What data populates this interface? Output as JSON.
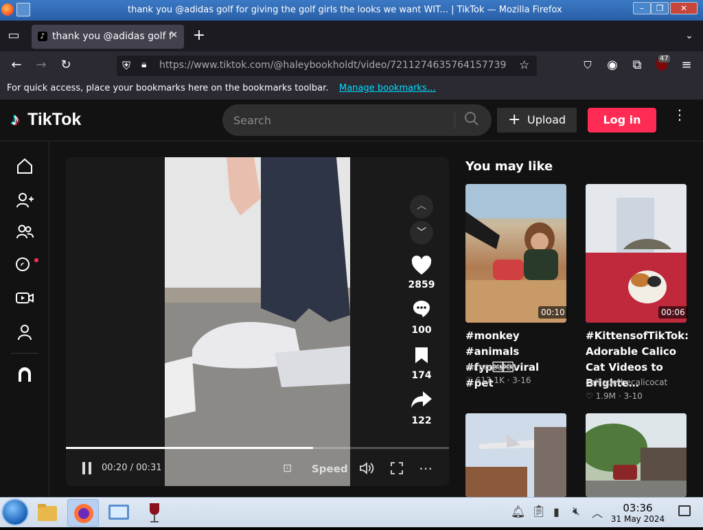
{
  "window": {
    "title": "thank you @adidas golf for giving the golf girls the looks we want WIT... | TikTok — Mozilla Firefox"
  },
  "browser": {
    "tab_label": "thank you @adidas golf f",
    "url": "https://www.tiktok.com/@haleybookholdt/video/7211274635764157739",
    "extensions_badge": "47",
    "bookmarks_text": "For quick access, place your bookmarks here on the bookmarks toolbar.",
    "bookmarks_link": "Manage bookmarks…"
  },
  "tiktok": {
    "logo_text": "TikTok",
    "search_placeholder": "Search",
    "upload_label": "Upload",
    "login_label": "Log in",
    "video": {
      "likes": "2859",
      "comments": "100",
      "saves": "174",
      "shares": "122",
      "time": "00:20 / 00:31",
      "speed_label": "Speed",
      "progress": 0.645
    },
    "recommended": {
      "heading": "You may like",
      "items": [
        {
          "duration": "00:10",
          "title": "#monkey #animals #fyp\u0011\u0011viral #pet",
          "author": "mr.porpor68",
          "likes": "613.1K",
          "date": "3-16"
        },
        {
          "duration": "00:06",
          "title": "#KittensofTikTok: Adorable Calico Cat Videos to Brighte…",
          "author": "calliopethecalicocat",
          "likes": "1.9M",
          "date": "3-10"
        }
      ]
    }
  },
  "taskbar": {
    "time": "03:36",
    "date": "31 May 2024"
  },
  "colors": {
    "accent": "#fe2c55",
    "bg": "#121212",
    "link": "#00ddff"
  }
}
